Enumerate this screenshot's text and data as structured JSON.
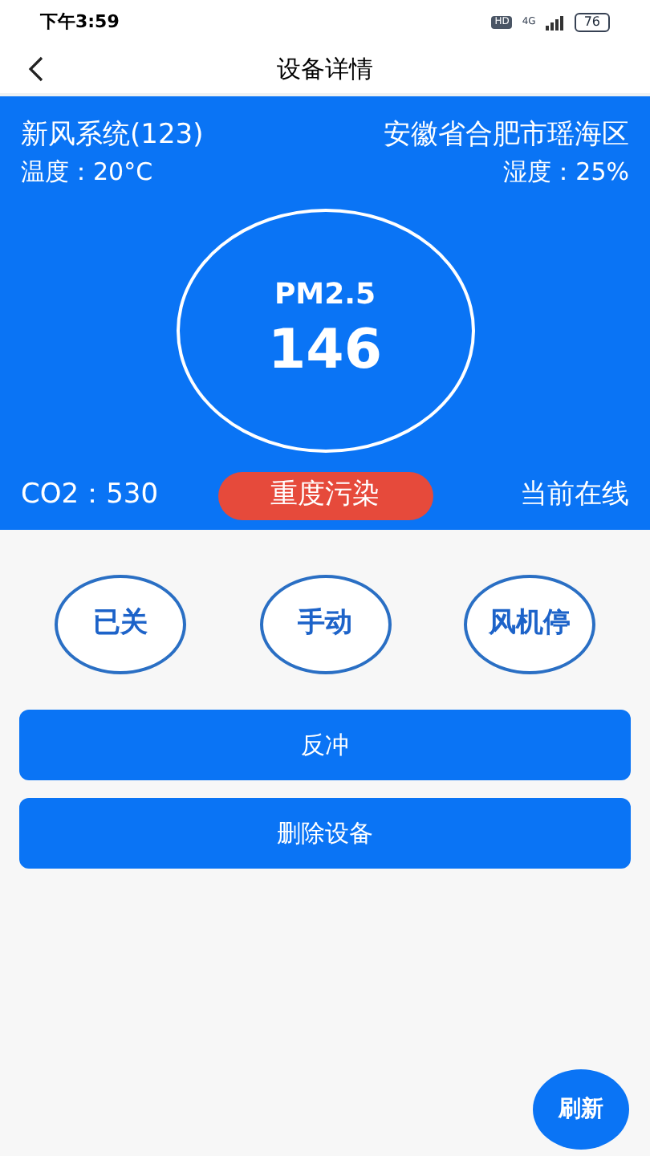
{
  "status_bar": {
    "time": "下午3:59",
    "hd": "HD",
    "network": "4G",
    "battery": "76"
  },
  "nav": {
    "title": "设备详情"
  },
  "device": {
    "name": "新风系统(123)",
    "location": "安徽省合肥市瑶海区",
    "temperature": "温度：20°C",
    "humidity": "湿度：25%",
    "pm_label": "PM2.5",
    "pm_value": "146",
    "co2": "CO2：530",
    "air_quality": "重度污染",
    "online": "当前在线"
  },
  "modes": [
    {
      "label": "已关"
    },
    {
      "label": "手动"
    },
    {
      "label": "风机停"
    }
  ],
  "actions": [
    {
      "label": "反冲"
    },
    {
      "label": "删除设备"
    }
  ],
  "refresh": "刷新"
}
